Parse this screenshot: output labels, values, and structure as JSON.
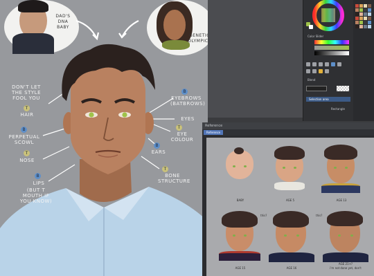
{
  "art": {
    "bubble_dad": "DAD'S DNA BABY",
    "bubble_mom": "GENETIC OLYMPICS",
    "notes": {
      "style": "DON'T LET THE STYLE FOOL YOU",
      "hair": "HAIR",
      "scowl": "PERPETUAL SCOWL",
      "nose": "NOSE",
      "lips": "LIPS",
      "mouth": "(BUT T MOUTH IF YOU KNOW)",
      "eyebrows": "EYEBROWS (BATBROWS)",
      "eyes": "EYES",
      "eye_colour": "EYE COLOUR",
      "ears": "EARS",
      "bone": "BONE STRUCTURE"
    },
    "markers": {
      "b": "B",
      "t": "T"
    }
  },
  "app": {
    "ref_window_title": "Reference",
    "ref_tab": "Reference",
    "palette_labels": [
      "Color Slider",
      "Blend",
      "Selection area",
      "Rectangle"
    ]
  },
  "reference": {
    "captions": [
      "BABY",
      "AGE 5",
      "AGE 13",
      "AGE 15",
      "AGE 16",
      "AGE 21+?"
    ],
    "notes": [
      "this?",
      "this?",
      "i'm not done yet, don't"
    ]
  },
  "colors": {
    "art_bg": "#97999d",
    "skin": "#b98160",
    "shirt": "#b9d3e8",
    "eye": "#9fc24a",
    "hair": "#2b211e",
    "accent_blue": "#5e8fc9",
    "accent_yellow": "#c9c17a"
  }
}
